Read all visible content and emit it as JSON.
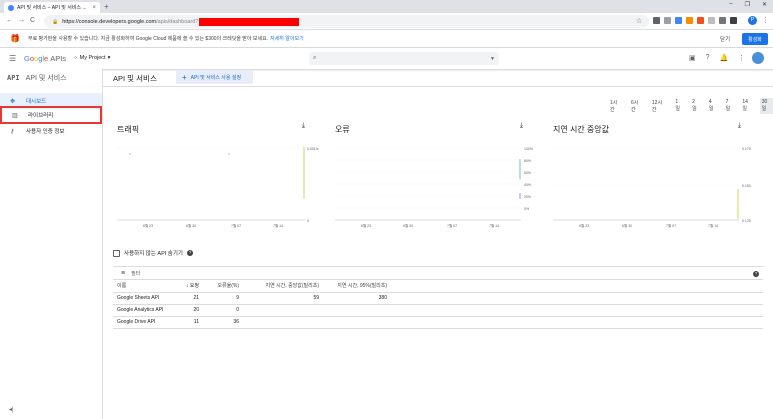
{
  "browser": {
    "tab_title": "API 및 서비스 – API 및 서비스 ...",
    "url_host": "https://console.developers.google.com",
    "url_path": "/apis/dashboard?",
    "colors": {
      "redaction": "#ff0000",
      "chrome_bg": "#dee1e6"
    }
  },
  "notice": {
    "text": "무료 평가판을 사용할 수 있습니다. 지금 활성화하여 Google Cloud 제품에 쓸 수 있는 $300의 크레딧을 받아 보세요.",
    "link": "자세히 알아보기",
    "dismiss": "닫기",
    "activate": "활성화"
  },
  "header": {
    "logo_google": [
      "G",
      "o",
      "o",
      "g",
      "l",
      "e"
    ],
    "logo_apis": "APIs",
    "project": "My Project"
  },
  "sidebar": {
    "logo": "API",
    "title": "API 및 서비스",
    "items": [
      {
        "label": "대시보드",
        "icon": "dashboard-icon"
      },
      {
        "label": "라이브러리",
        "icon": "library-icon"
      },
      {
        "label": "사용자 인증 정보",
        "icon": "key-icon"
      }
    ]
  },
  "main": {
    "title": "API 및 서비스",
    "enable_button": "API 및 서비스 사용 설정",
    "ranges": [
      "1시간",
      "6시간",
      "12시간",
      "1일",
      "2일",
      "4일",
      "7일",
      "14일",
      "30일"
    ],
    "selected_range": "30일",
    "hide_unused": "사용하지 않는 API 숨기기",
    "filter": "필터"
  },
  "chart_data": [
    {
      "type": "line",
      "title": "트래픽",
      "x_ticks": [
        "6월 23",
        "6월 30",
        "7월 07",
        "7월 14"
      ],
      "y_ticks": [
        "0.001/s",
        "0"
      ]
    },
    {
      "type": "line",
      "title": "오류",
      "x_ticks": [
        "6월 23",
        "6월 30",
        "7월 07",
        "7월 14"
      ],
      "y_ticks": [
        "100%",
        "80%",
        "60%",
        "40%",
        "20%",
        "0%"
      ]
    },
    {
      "type": "line",
      "title": "지연 시간 중앙값",
      "x_ticks": [
        "6월 23",
        "6월 30",
        "7월 07",
        "7월 14"
      ],
      "y_ticks": [
        "0.175",
        "0.150",
        "0.125"
      ]
    }
  ],
  "table": {
    "headers": [
      "이름",
      "요청",
      "오류율(%)",
      "지연 시간, 중앙값(밀리초)",
      "지연 시간, 95%(밀리초)"
    ],
    "rows": [
      [
        "Google Sheets API",
        "21",
        "9",
        "59",
        "380"
      ],
      [
        "Google Analytics API",
        "20",
        "0",
        "",
        ""
      ],
      [
        "Google Drive API",
        "11",
        "36",
        "",
        ""
      ]
    ]
  }
}
